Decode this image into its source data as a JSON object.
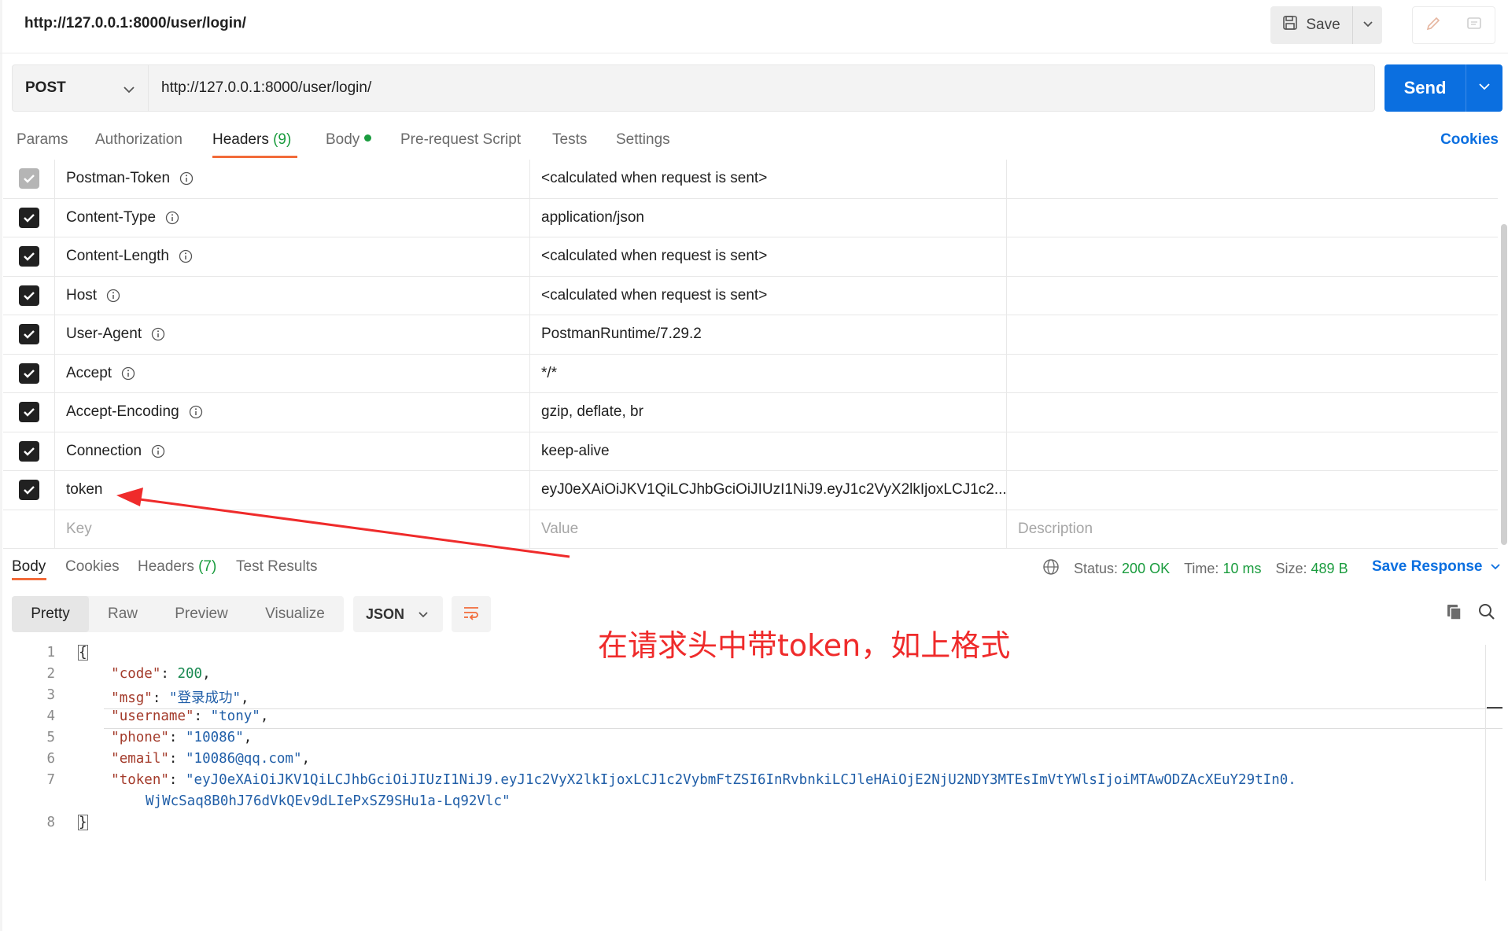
{
  "tab_title": "http://127.0.0.1:8000/user/login/",
  "save_label": "Save",
  "request": {
    "method": "POST",
    "url": "http://127.0.0.1:8000/user/login/",
    "send_label": "Send"
  },
  "request_tabs": {
    "params": "Params",
    "authorization": "Authorization",
    "headers": "Headers",
    "headers_count": "(9)",
    "body": "Body",
    "pre_request": "Pre-request Script",
    "tests": "Tests",
    "settings": "Settings",
    "cookies": "Cookies"
  },
  "headers": [
    {
      "key": "Postman-Token",
      "value": "<calculated when request is sent>",
      "checked": true,
      "disabled": true,
      "info": true
    },
    {
      "key": "Content-Type",
      "value": "application/json",
      "checked": true,
      "disabled": false,
      "info": true
    },
    {
      "key": "Content-Length",
      "value": "<calculated when request is sent>",
      "checked": true,
      "disabled": false,
      "info": true
    },
    {
      "key": "Host",
      "value": "<calculated when request is sent>",
      "checked": true,
      "disabled": false,
      "info": true
    },
    {
      "key": "User-Agent",
      "value": "PostmanRuntime/7.29.2",
      "checked": true,
      "disabled": false,
      "info": true
    },
    {
      "key": "Accept",
      "value": "*/*",
      "checked": true,
      "disabled": false,
      "info": true
    },
    {
      "key": "Accept-Encoding",
      "value": "gzip, deflate, br",
      "checked": true,
      "disabled": false,
      "info": true
    },
    {
      "key": "Connection",
      "value": "keep-alive",
      "checked": true,
      "disabled": false,
      "info": true
    },
    {
      "key": "token",
      "value": "eyJ0eXAiOiJKV1QiLCJhbGciOiJIUzI1NiJ9.eyJ1c2VyX2lkIjoxLCJ1c2...",
      "checked": true,
      "disabled": false,
      "info": false
    }
  ],
  "headers_placeholder": {
    "key": "Key",
    "value": "Value",
    "description": "Description"
  },
  "response_tabs": {
    "body": "Body",
    "cookies": "Cookies",
    "headers": "Headers",
    "headers_count": "(7)",
    "test_results": "Test Results"
  },
  "response_status": {
    "status_label": "Status:",
    "status_value": "200 OK",
    "time_label": "Time:",
    "time_value": "10 ms",
    "size_label": "Size:",
    "size_value": "489 B",
    "save_response": "Save Response"
  },
  "view_modes": {
    "pretty": "Pretty",
    "raw": "Raw",
    "preview": "Preview",
    "visualize": "Visualize"
  },
  "format": "JSON",
  "annotation": "在请求头中带token，如上格式",
  "code": {
    "line_numbers": [
      "1",
      "2",
      "3",
      "4",
      "5",
      "6",
      "7",
      "8"
    ],
    "open_brace": "{",
    "close_brace": "}",
    "code_key": "\"code\"",
    "code_val": "200",
    "msg_key": "\"msg\"",
    "msg_val": "\"登录成功\"",
    "username_key": "\"username\"",
    "username_val": "\"tony\"",
    "phone_key": "\"phone\"",
    "phone_val": "\"10086\"",
    "email_key": "\"email\"",
    "email_val": "\"10086@qq.com\"",
    "token_key": "\"token\"",
    "token_val_1": "\"eyJ0eXAiOiJKV1QiLCJhbGciOiJIUzI1NiJ9.eyJ1c2VyX2lkIjoxLCJ1c2VybmFtZSI6InRvbnkiLCJleHAiOjE2NjU2NDY3MTEsImVtYWlsIjoiMTAwODZAcXEuY29tIn0.",
    "token_val_2": "WjWcSaq8B0hJ76dVkQEv9dLIePxSZ9SHu1a-Lq92Vlc\""
  }
}
